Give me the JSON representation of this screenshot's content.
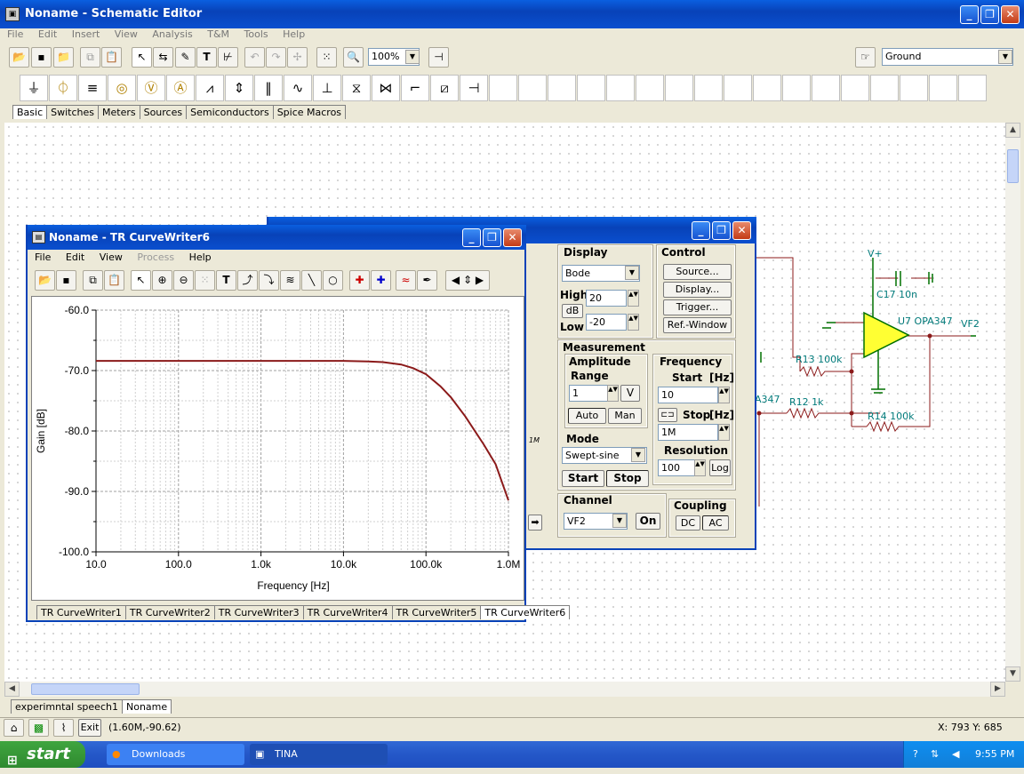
{
  "app": {
    "title": "Noname - Schematic Editor"
  },
  "menu": [
    "File",
    "Edit",
    "Insert",
    "View",
    "Analysis",
    "T&M",
    "Tools",
    "Help"
  ],
  "toolbar": {
    "zoom": "100%",
    "ground_select": "Ground"
  },
  "component_tabs": [
    "Basic",
    "Switches",
    "Meters",
    "Sources",
    "Semiconductors",
    "Spice Macros"
  ],
  "doc_tabs": [
    "experimntal speech1",
    "Noname"
  ],
  "schematic": {
    "labels": [
      "V+",
      "C17 10n",
      "U7 OPA347",
      "VF2",
      "R13 100k",
      "R12 1k",
      "R14 100k",
      "A347"
    ]
  },
  "curvewriter": {
    "title": "Noname - TR CurveWriter6",
    "menu": [
      "File",
      "Edit",
      "View",
      "Process",
      "Help"
    ],
    "tabs": [
      "TR CurveWriter1",
      "TR CurveWriter2",
      "TR CurveWriter3",
      "TR CurveWriter4",
      "TR CurveWriter5",
      "TR CurveWriter6"
    ]
  },
  "chart_data": {
    "type": "line",
    "xlabel": "Frequency [Hz]",
    "ylabel": "Gain [dB]",
    "xscale": "log",
    "xlim": [
      10,
      1000000
    ],
    "ylim": [
      -100,
      -60
    ],
    "x_ticks": [
      "10.0",
      "100.0",
      "1.0k",
      "10.0k",
      "100.0k",
      "1.0M"
    ],
    "y_ticks": [
      "-60.0",
      "-70.0",
      "-80.0",
      "-90.0",
      "-100.0"
    ],
    "grid": true,
    "color": "#8b1a1a",
    "series": [
      {
        "x": [
          10,
          100,
          1000,
          10000,
          20000,
          30000,
          50000,
          70000,
          100000,
          150000,
          200000,
          300000,
          500000,
          700000,
          1000000
        ],
        "values": [
          -68.4,
          -68.4,
          -68.4,
          -68.4,
          -68.5,
          -68.6,
          -69.0,
          -69.6,
          -70.6,
          -72.6,
          -74.4,
          -77.6,
          -82.2,
          -85.5,
          -91.5
        ]
      }
    ]
  },
  "controls": {
    "display": {
      "title": "Display",
      "mode": "Bode",
      "high_label": "High",
      "high": "20",
      "db_label": "dB",
      "low_label": "Low",
      "low": "-20"
    },
    "control": {
      "title": "Control",
      "buttons": [
        "Source...",
        "Display...",
        "Trigger...",
        "Ref.-Window"
      ]
    },
    "measurement": {
      "title": "Measurement",
      "amplitude": "Amplitude",
      "range_label": "Range",
      "range": "1",
      "unit": "V",
      "auto": "Auto",
      "man": "Man",
      "frequency": "Frequency",
      "start_label": "Start",
      "start_unit": "[Hz]",
      "start": "10",
      "stop_label": "Stop",
      "stop_unit": "[Hz]",
      "stop": "1M",
      "mode_label": "Mode",
      "mode": "Swept-sine",
      "resolution_label": "Resolution",
      "resolution": "100",
      "log": "Log",
      "start_btn": "Start",
      "stop_btn": "Stop"
    },
    "channel": {
      "title": "Channel",
      "value": "VF2",
      "on": "On"
    },
    "coupling": {
      "title": "Coupling",
      "dc": "DC",
      "ac": "AC"
    },
    "side_fragment": "1M"
  },
  "status": {
    "exit": "Exit",
    "coords": "(1.60M,-90.62)",
    "xy": "X: 793  Y: 685"
  },
  "taskbar": {
    "start": "start",
    "items": [
      "Downloads",
      "TINA"
    ],
    "time": "9:55 PM"
  }
}
